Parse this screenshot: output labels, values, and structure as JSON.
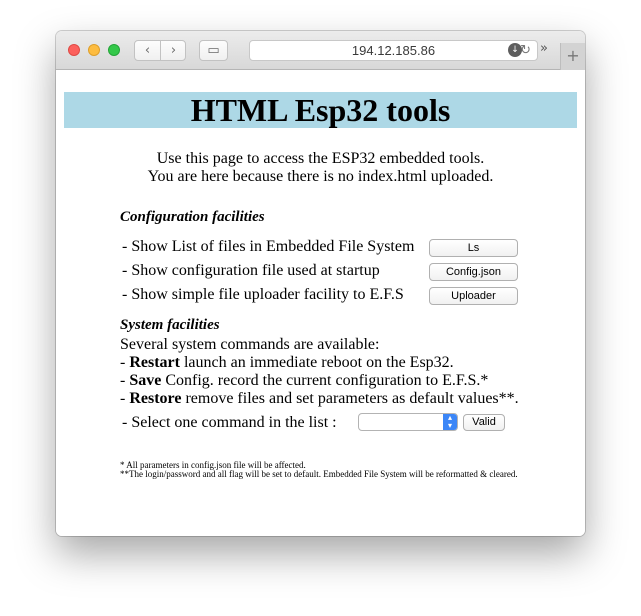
{
  "browser": {
    "url": "194.12.185.86",
    "back_glyph": "‹",
    "forward_glyph": "›",
    "sidebar_glyph": "▭",
    "reload_glyph": "↻",
    "download_glyph": "↓",
    "more_glyph": "»",
    "new_tab_glyph": "+"
  },
  "page": {
    "title": "HTML Esp32 tools",
    "intro_line1": "Use this page to access the ESP32 embedded tools.",
    "intro_line2": "You are here because there is no index.html uploaded.",
    "config_heading": "Configuration facilities",
    "config_rows": [
      {
        "text": "- Show List of files in Embedded File System",
        "button": "Ls"
      },
      {
        "text": "- Show configuration file used at startup",
        "button": "Config.json"
      },
      {
        "text": "- Show simple file uploader facility to E.F.S",
        "button": "Uploader"
      }
    ],
    "system_heading": "System facilities",
    "system_intro": "Several system commands are available:",
    "commands": [
      {
        "prefix": "- ",
        "name": "Restart",
        "desc": " launch an immediate reboot on the Esp32."
      },
      {
        "prefix": "- ",
        "name": "Save",
        "desc": " Config. record the current configuration to E.F.S.*"
      },
      {
        "prefix": "- ",
        "name": "Restore",
        "desc": " remove files and set parameters as default values**."
      }
    ],
    "select_label": "- Select one command in the list :",
    "select_value": "",
    "valid_button": "Valid",
    "footnote1": "* All parameters in config.json file will be affected.",
    "footnote2": "**The login/password and all flag will be set to default. Embedded File System will be reformatted & cleared."
  }
}
